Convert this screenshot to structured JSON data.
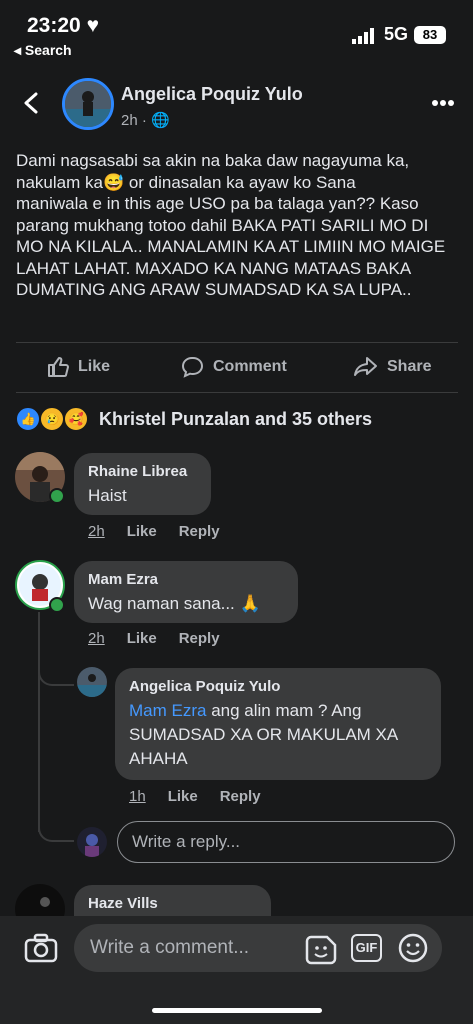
{
  "status_bar": {
    "time": "23:20",
    "back_label": "◂ Search",
    "network": "5G",
    "battery": "83"
  },
  "post": {
    "author": "Angelica Poquiz Yulo",
    "time": "2h",
    "text_line1": "Dami nagsasabi sa akin na baka daw nagayuma ka,",
    "text_line2a": "nakulam ka",
    "text_line2_emoji": "😅",
    "text_line2b": " or dinasalan ka ayaw ko Sana",
    "text_rest": "maniwala e in this age USO pa ba talaga yan?? Kaso parang mukhang totoo dahil BAKA PATI SARILI MO DI MO NA KILALA.. MANALAMIN KA AT LIMIIN MO MAIGE LAHAT LAHAT. MAXADO KA NANG MATAAS BAKA DUMATING ANG ARAW SUMADSAD KA SA LUPA..",
    "actions": {
      "like": "Like",
      "comment": "Comment",
      "share": "Share"
    },
    "reactions": {
      "icons": [
        "like",
        "sad",
        "care"
      ],
      "summary": "Khristel Punzalan and 35 others"
    }
  },
  "comments": [
    {
      "name": "Rhaine Librea",
      "text": "Haist",
      "time": "2h",
      "like": "Like",
      "reply": "Reply"
    },
    {
      "name": "Mam Ezra",
      "text": "Wag naman sana... 🙏",
      "time": "2h",
      "like": "Like",
      "reply": "Reply"
    },
    {
      "name": "Angelica Poquiz Yulo",
      "mention": "Mam Ezra",
      "text": " ang alin mam ? Ang SUMADSAD XA OR MAKULAM XA AHAHA",
      "time": "1h",
      "like": "Like",
      "reply": "Reply"
    },
    {
      "name": "Haze Vills"
    }
  ],
  "reply_placeholder": "Write a reply...",
  "comment_placeholder": "Write a comment...",
  "gif_label": "GIF",
  "colors": {
    "background": "#18191a",
    "bubble": "#3a3b3c",
    "accent": "#2d88ff",
    "online": "#31a24c",
    "mention": "#4599ff"
  }
}
